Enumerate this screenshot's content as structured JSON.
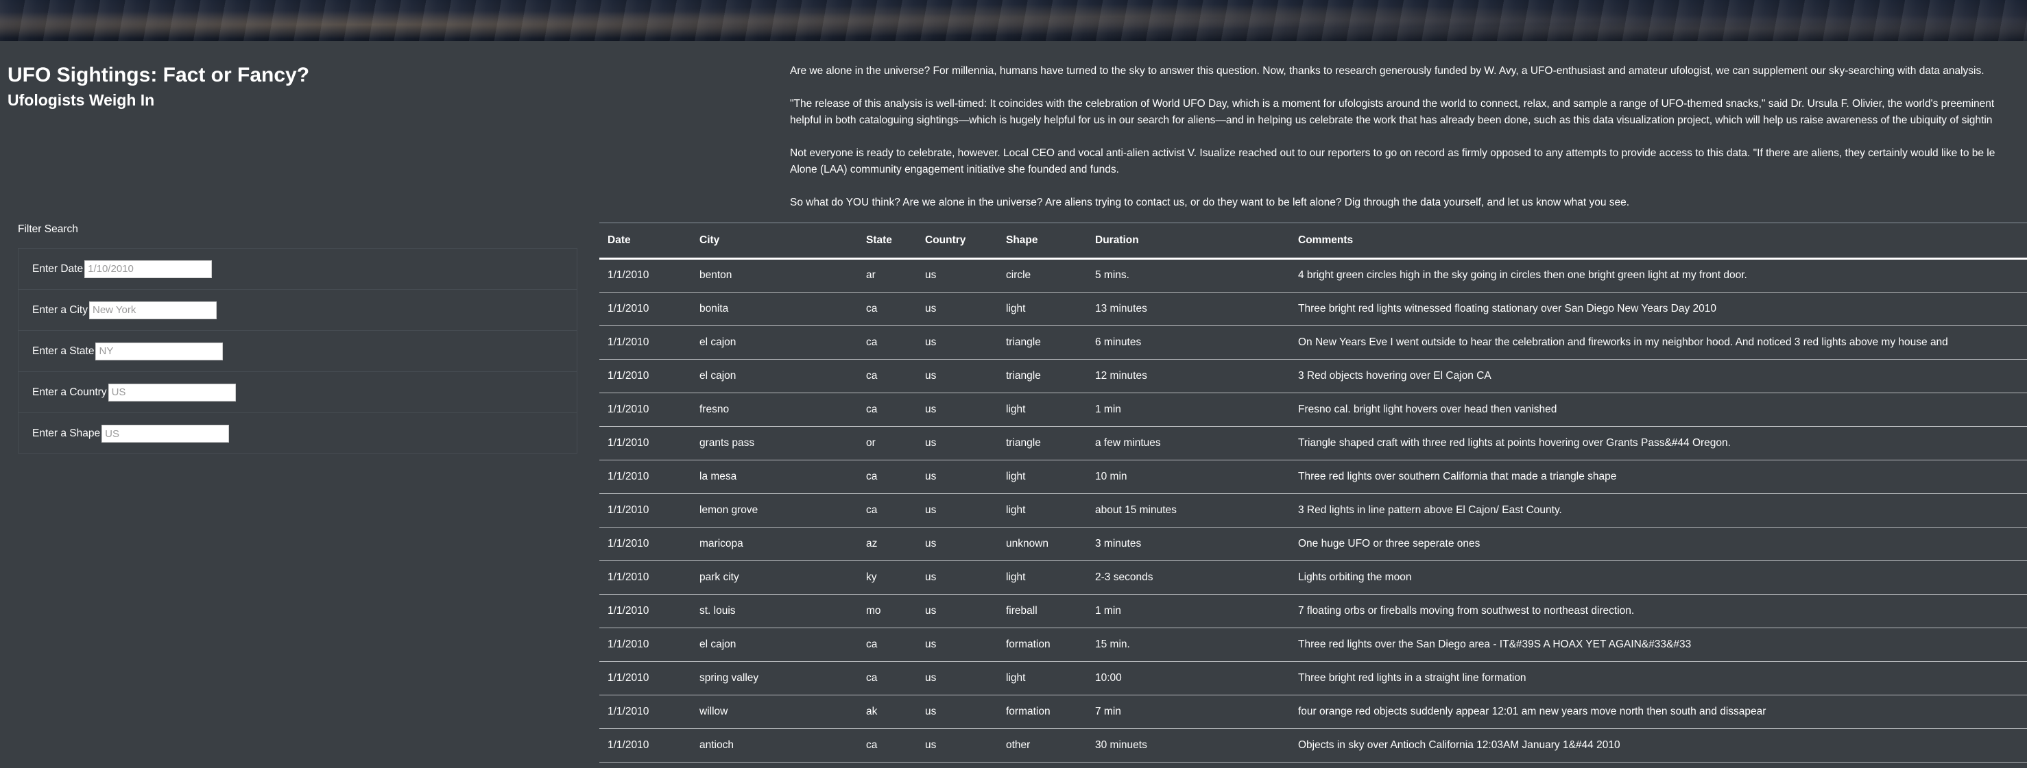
{
  "header": {
    "title": "UFO Sightings: Fact or Fancy?",
    "subtitle": "Ufologists Weigh In"
  },
  "intro": {
    "paragraphs": [
      "Are we alone in the universe? For millennia, humans have turned to the sky to answer this question. Now, thanks to research generously funded by W. Avy, a UFO-enthusiast and amateur ufologist, we can supplement our sky-searching with data analysis.",
      "\"The release of this analysis is well-timed: It coincides with the celebration of World UFO Day, which is a moment for ufologists around the world to connect, relax, and sample a range of UFO-themed snacks,\" said Dr. Ursula F. Olivier, the world's preeminent",
      "helpful in both cataloguing sightings—which is hugely helpful for us in our search for aliens—and in helping us celebrate the work that has already been done, such as this data visualization project, which will help us raise awareness of the ubiquity of sightin",
      "Not everyone is ready to celebrate, however. Local CEO and vocal anti-alien activist V. Isualize reached out to our reporters to go on record as firmly opposed to any attempts to provide access to this data. \"If there are aliens, they certainly would like to be le",
      "Alone (LAA) community engagement initiative she founded and funds.",
      "So what do YOU think? Are we alone in the universe? Are aliens trying to contact us, or do they want to be left alone? Dig through the data yourself, and let us know what you see."
    ]
  },
  "filters": {
    "title": "Filter Search",
    "date": {
      "label": "Enter Date",
      "placeholder": "1/10/2010"
    },
    "city": {
      "label": "Enter a City",
      "placeholder": "New York"
    },
    "state": {
      "label": "Enter a State",
      "placeholder": "NY"
    },
    "country": {
      "label": "Enter a Country",
      "placeholder": "US"
    },
    "shape": {
      "label": "Enter a Shape",
      "placeholder": "US"
    }
  },
  "table": {
    "headers": [
      "Date",
      "City",
      "State",
      "Country",
      "Shape",
      "Duration",
      "Comments"
    ],
    "rows": [
      [
        "1/1/2010",
        "benton",
        "ar",
        "us",
        "circle",
        "5 mins.",
        "4 bright green circles high in the sky going in circles then one bright green light at my front door."
      ],
      [
        "1/1/2010",
        "bonita",
        "ca",
        "us",
        "light",
        "13 minutes",
        "Three bright red lights witnessed floating stationary over San Diego New Years Day 2010"
      ],
      [
        "1/1/2010",
        "el cajon",
        "ca",
        "us",
        "triangle",
        "6 minutes",
        "On New Years Eve I went outside to hear the celebration and fireworks in my neighbor hood. And noticed 3 red lights above my house and"
      ],
      [
        "1/1/2010",
        "el cajon",
        "ca",
        "us",
        "triangle",
        "12 minutes",
        "3 Red objects hovering over El Cajon CA"
      ],
      [
        "1/1/2010",
        "fresno",
        "ca",
        "us",
        "light",
        "1 min",
        "Fresno cal. bright light hovers over head then vanished"
      ],
      [
        "1/1/2010",
        "grants pass",
        "or",
        "us",
        "triangle",
        "a few mintues",
        "Triangle shaped craft with three red lights at points hovering over Grants Pass&#44 Oregon."
      ],
      [
        "1/1/2010",
        "la mesa",
        "ca",
        "us",
        "light",
        "10 min",
        "Three red lights over southern California that made a triangle shape"
      ],
      [
        "1/1/2010",
        "lemon grove",
        "ca",
        "us",
        "light",
        "about 15 minutes",
        "3 Red lights in line pattern above El Cajon/ East County."
      ],
      [
        "1/1/2010",
        "maricopa",
        "az",
        "us",
        "unknown",
        "3 minutes",
        "One huge UFO or three seperate ones"
      ],
      [
        "1/1/2010",
        "park city",
        "ky",
        "us",
        "light",
        "2-3 seconds",
        "Lights orbiting the moon"
      ],
      [
        "1/1/2010",
        "st. louis",
        "mo",
        "us",
        "fireball",
        "1 min",
        "7 floating orbs or fireballs moving from southwest to northeast direction."
      ],
      [
        "1/1/2010",
        "el cajon",
        "ca",
        "us",
        "formation",
        "15 min.",
        "Three red lights over the San Diego area - IT&#39S A HOAX YET AGAIN&#33&#33"
      ],
      [
        "1/1/2010",
        "spring valley",
        "ca",
        "us",
        "light",
        "10:00",
        "Three bright red lights in a straight line formation"
      ],
      [
        "1/1/2010",
        "willow",
        "ak",
        "us",
        "formation",
        "7 min",
        "four orange red objects suddenly appear 12:01 am new years move north then south and dissapear"
      ],
      [
        "1/1/2010",
        "antioch",
        "ca",
        "us",
        "other",
        "30 minuets",
        "Objects in sky over Antioch California 12:03AM January 1&#44 2010"
      ]
    ]
  }
}
